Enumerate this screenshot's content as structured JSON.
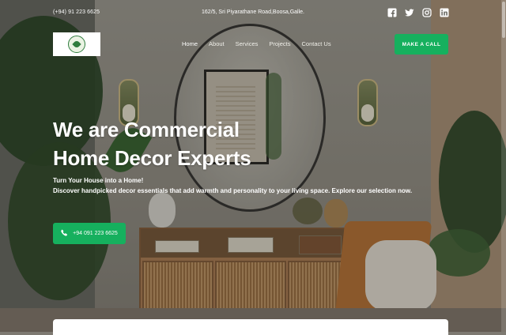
{
  "topbar": {
    "phone": "(+94) 91 223 6625",
    "address": "162/5, Sri Piyarathane Road,Boosa,Galle.",
    "socials": [
      "facebook-icon",
      "twitter-icon",
      "instagram-icon",
      "linkedin-icon"
    ]
  },
  "nav": {
    "items": [
      {
        "label": "Home",
        "active": true
      },
      {
        "label": "About"
      },
      {
        "label": "Services"
      },
      {
        "label": "Projects"
      },
      {
        "label": "Contact Us"
      }
    ],
    "cta_label": "MAKE A CALL"
  },
  "hero": {
    "title_line1": "We are Commercial",
    "title_line2": "Home Decor Experts",
    "subtitle_line1": "Turn Your House into a Home!",
    "subtitle_line2": "Discover handpicked decor essentials that add warmth and personality to your living space. Explore our selection now.",
    "phone_button_label": "+94 091 223 6625"
  },
  "colors": {
    "accent": "#16b05e",
    "text": "#ffffff"
  }
}
